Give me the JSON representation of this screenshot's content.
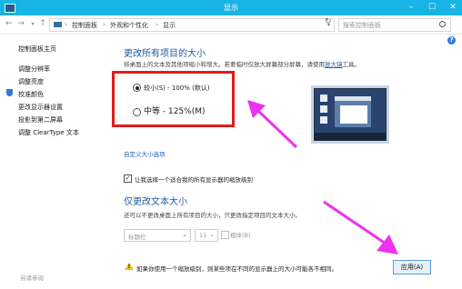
{
  "window": {
    "title": "显示"
  },
  "address": {
    "path": [
      "控制面板",
      "外观和个性化",
      "显示"
    ],
    "search_placeholder": "搜索控制面板"
  },
  "sidebar": {
    "items": [
      "控制面板主页",
      "调整分辨率",
      "调整亮度",
      "校准颜色",
      "更改显示器设置",
      "投影到第二屏幕",
      "调整 ClearType 文本"
    ],
    "bottom_link": "另请参阅"
  },
  "main": {
    "heading": "更改所有项目的大小",
    "desc_prefix": "将桌面上的文本及其他项缩小和增大。若要临时仅放大屏幕部分屏幕，请使用",
    "desc_link": "放大镜",
    "desc_suffix": "工具。",
    "option1": "较小(S) - 100% (默认)",
    "option2": "中等 - 125%(M)",
    "custom_link": "自定义大小选项",
    "checkbox_label": "让我选择一个适合我的所有显示器的缩放级别",
    "heading2": "仅更改文本大小",
    "desc2": "还可以不更改桌面上所有项目的大小，只更改指定项目的文本大小。",
    "select_item": "标题栏",
    "select_size": "11",
    "bold_label": "粗体(B)",
    "warning": "如果你使用一个缩放级别，则某些项在不同的显示器上的大小可能各不相同。",
    "apply": "应用(A)"
  },
  "colors": {
    "accent": "#18b4e6",
    "heading": "#1e5a9e",
    "highlight": "#e21b1b",
    "arrow": "#ee32ee"
  }
}
